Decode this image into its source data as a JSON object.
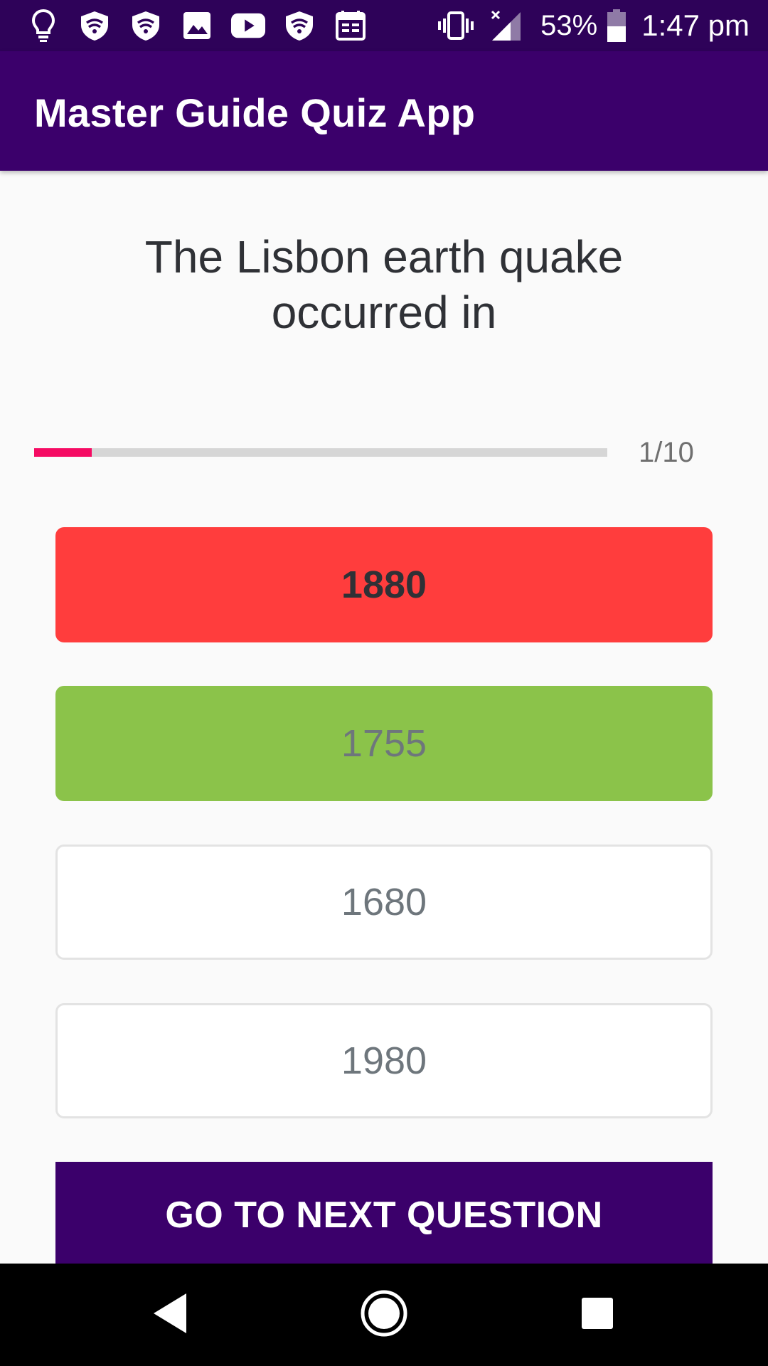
{
  "status_bar": {
    "notification_icons": [
      "lightbulb-icon",
      "shield-wifi-icon",
      "shield-wifi-icon",
      "image-icon",
      "youtube-icon",
      "shield-wifi-icon",
      "calendar-icon"
    ],
    "battery_percent": "53%",
    "time": "1:47 pm"
  },
  "app_bar": {
    "title": "Master Guide Quiz App"
  },
  "quiz": {
    "question": "The Lisbon earth quake occurred in",
    "progress": {
      "current": 1,
      "total": 10,
      "label": "1/10"
    },
    "options": [
      {
        "label": "1880",
        "state": "selected-wrong",
        "color": "#ff3d3d"
      },
      {
        "label": "1755",
        "state": "correct",
        "color": "#8bc34a"
      },
      {
        "label": "1680",
        "state": "neutral",
        "color": "#ffffff"
      },
      {
        "label": "1980",
        "state": "neutral",
        "color": "#ffffff"
      }
    ],
    "next_label": "GO TO NEXT QUESTION"
  },
  "colors": {
    "status_bar": "#2e0259",
    "primary": "#3b006b",
    "accent": "#f50b63",
    "wrong": "#ff3d3d",
    "correct": "#8bc34a"
  },
  "nav_bar": {
    "icons": [
      "back-icon",
      "home-icon",
      "recent-apps-icon"
    ]
  }
}
